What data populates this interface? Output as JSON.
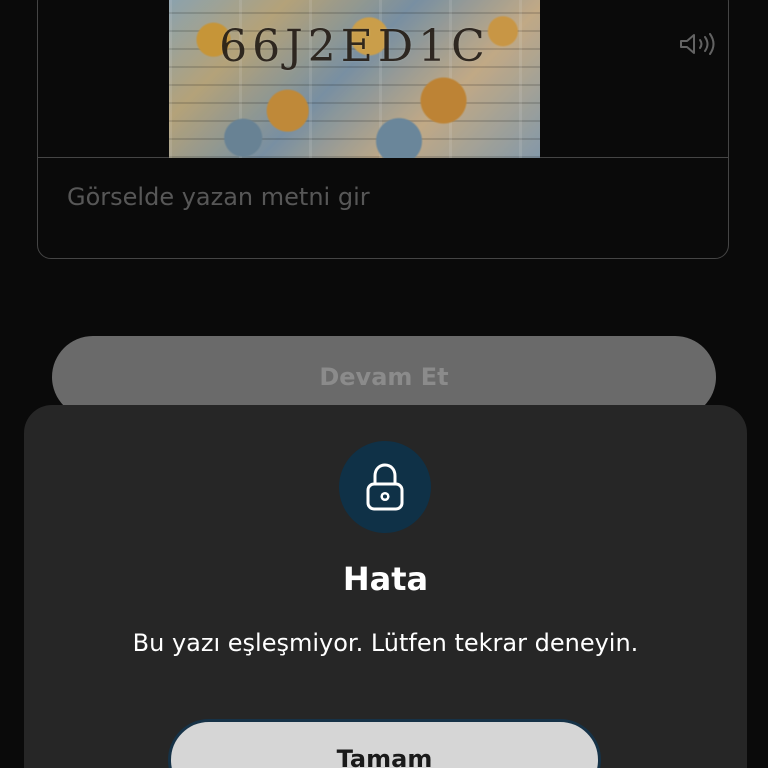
{
  "captcha": {
    "image_text": "66J2ED1C",
    "speaker_icon": "speaker-icon"
  },
  "input": {
    "placeholder": "Görselde yazan metni gir",
    "value": ""
  },
  "actions": {
    "continue_label": "Devam Et"
  },
  "error_dialog": {
    "icon": "lock-icon",
    "title": "Hata",
    "message": "Bu yazı eşleşmiyor. Lütfen tekrar deneyin.",
    "button_label": "Tamam"
  },
  "colors": {
    "background": "#0b0b0b",
    "sheet_background": "#262626",
    "lock_badge": "#0f3147",
    "primary_text": "#ffffff",
    "disabled_button": "#747474",
    "light_button": "#d6d6d6"
  }
}
